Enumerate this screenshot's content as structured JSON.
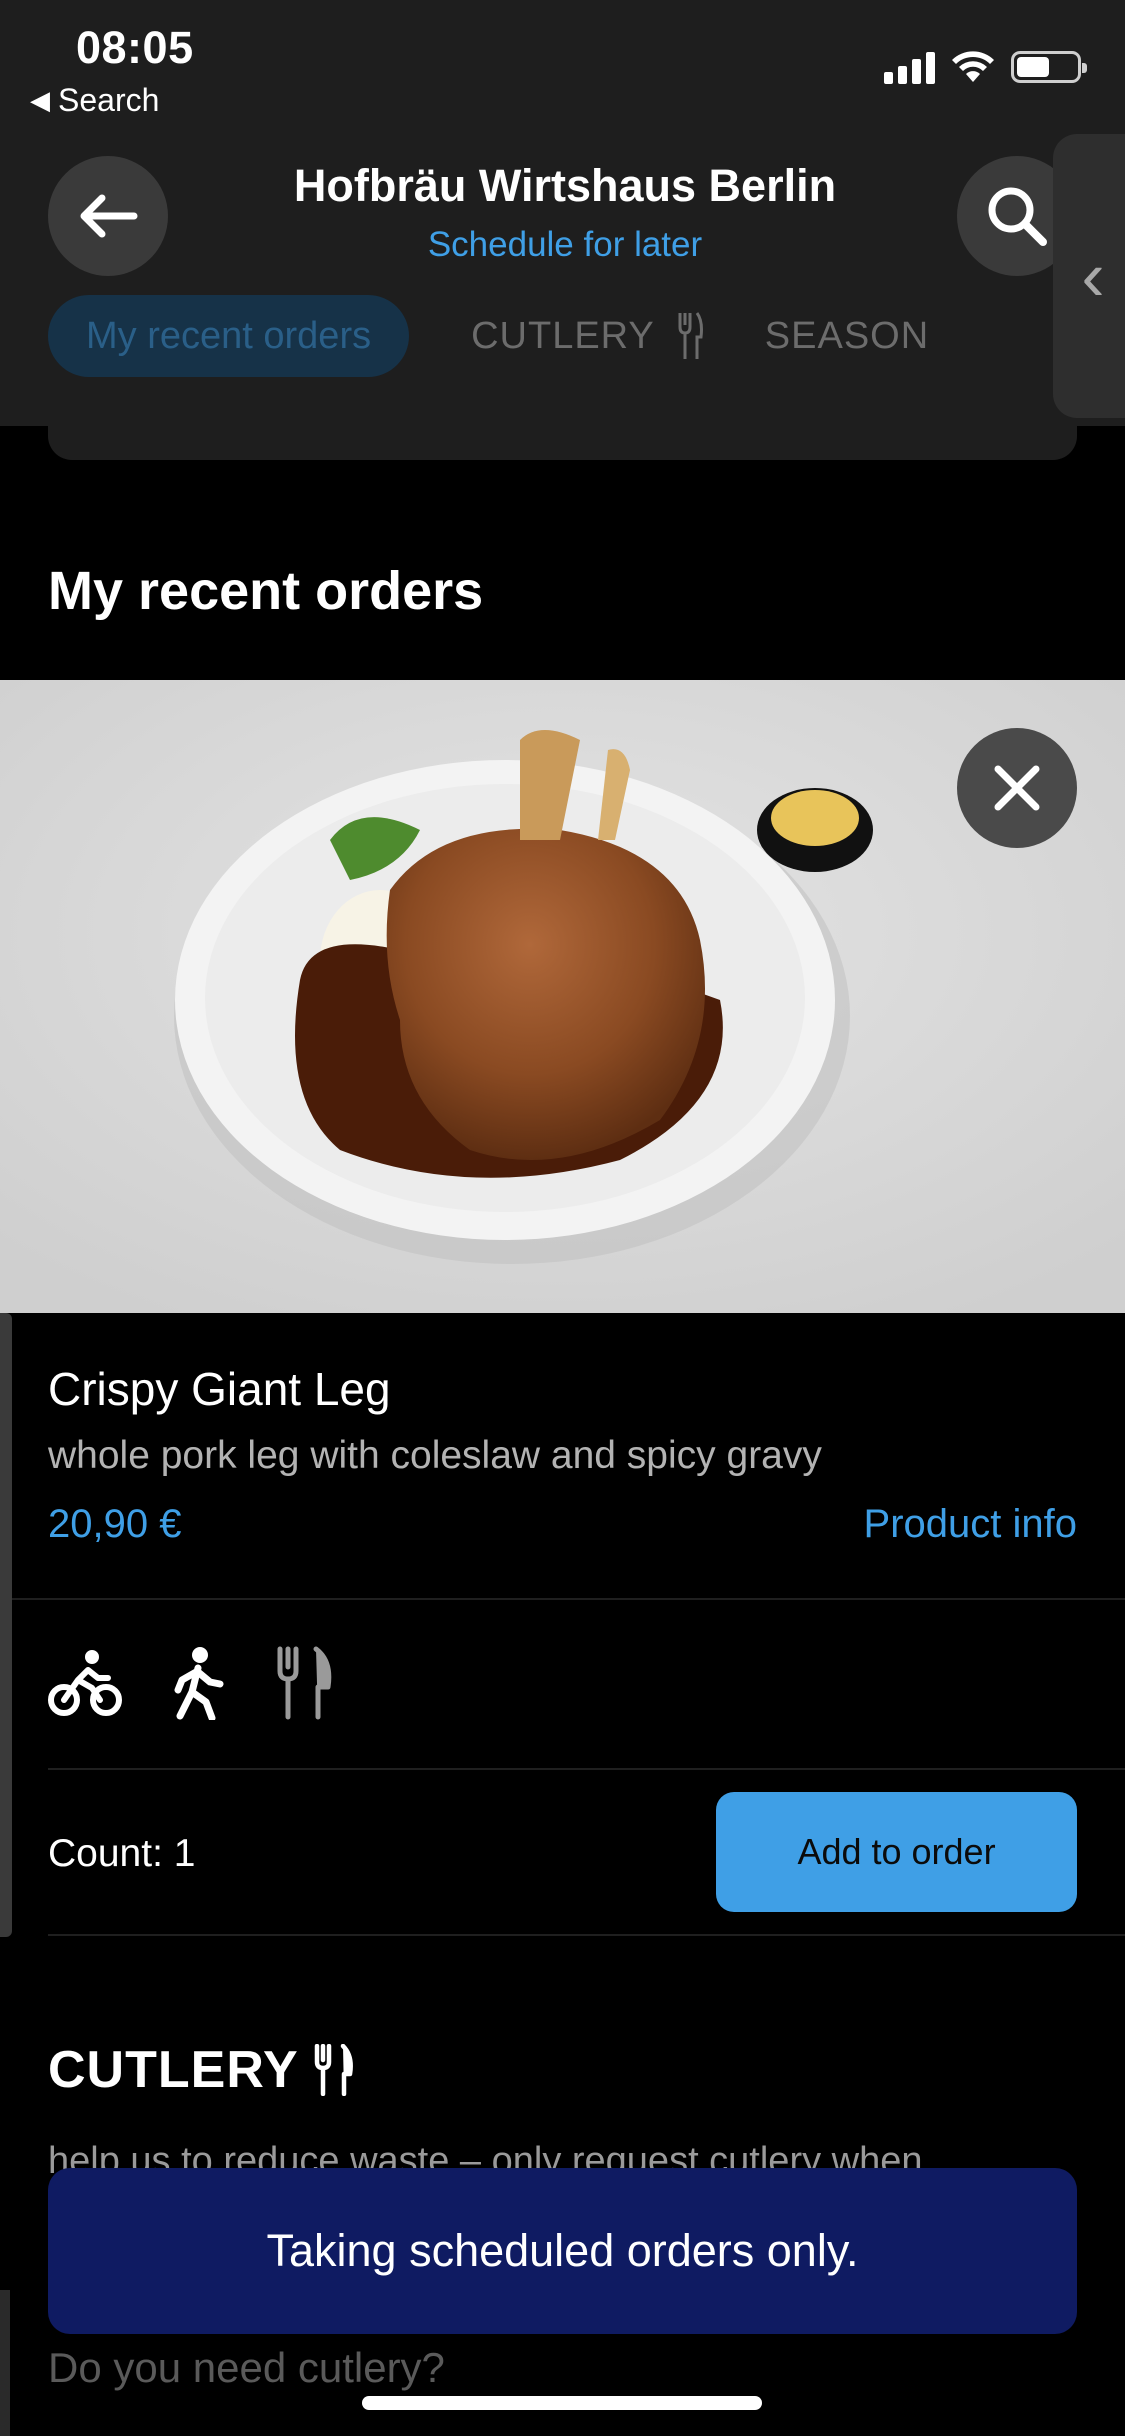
{
  "status_bar": {
    "time": "08:05",
    "back_label": "Search"
  },
  "header": {
    "title": "Hofbräu Wirtshaus Berlin",
    "subtitle": "Schedule for later"
  },
  "tabs": {
    "active": "My recent orders",
    "items": [
      "CUTLERY",
      "SEASON"
    ]
  },
  "section_title": "My recent orders",
  "product": {
    "name": "Crispy Giant Leg",
    "description": "whole pork leg with coleslaw and spicy gravy",
    "price": "20,90 €",
    "info_link": "Product info",
    "modes": [
      "bike-icon",
      "walking-icon",
      "cutlery-icon"
    ],
    "count_label": "Count: 1",
    "add_button": "Add to order"
  },
  "cutlery": {
    "title": "CUTLERY",
    "description": "help us to reduce waste – only request cutlery when",
    "question": "Do you need cutlery?"
  },
  "banner": "Taking scheduled orders only.",
  "colors": {
    "accent": "#3f9fe6",
    "banner": "#0f1b62",
    "header": "#1e1e1e"
  }
}
